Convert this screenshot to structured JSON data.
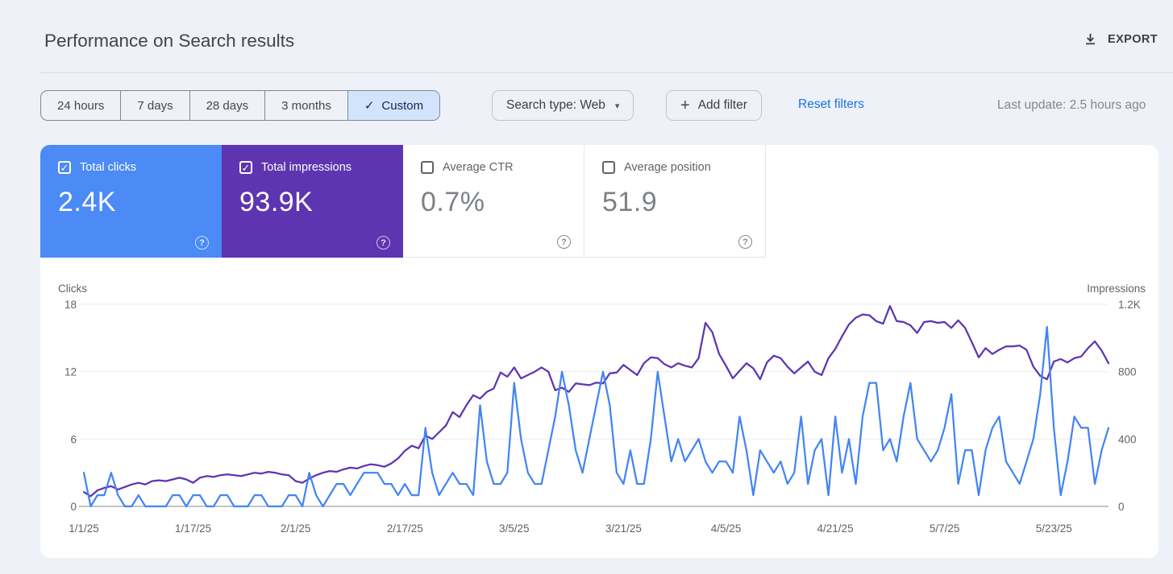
{
  "header": {
    "title": "Performance on Search results",
    "export_label": "EXPORT"
  },
  "icons": {
    "check": "✓",
    "caret_down": "▾",
    "plus": "+",
    "help": "?"
  },
  "filters": {
    "date_tabs": [
      {
        "label": "24 hours",
        "selected": false
      },
      {
        "label": "7 days",
        "selected": false
      },
      {
        "label": "28 days",
        "selected": false
      },
      {
        "label": "3 months",
        "selected": false
      },
      {
        "label": "Custom",
        "selected": true
      }
    ],
    "search_type_label": "Search type: Web",
    "add_filter_label": "Add filter",
    "reset_label": "Reset filters",
    "last_update": "Last update: 2.5 hours ago"
  },
  "metrics": [
    {
      "label": "Total clicks",
      "value": "2.4K",
      "checked": true,
      "color": "#4c8af5"
    },
    {
      "label": "Total impressions",
      "value": "93.9K",
      "checked": true,
      "color": "#5e35b1"
    },
    {
      "label": "Average CTR",
      "value": "0.7%",
      "checked": false,
      "color": "#ffffff"
    },
    {
      "label": "Average position",
      "value": "51.9",
      "checked": false,
      "color": "#ffffff"
    }
  ],
  "chart_data": {
    "type": "line",
    "grid": true,
    "x_axis": {
      "unit": "day",
      "start": "1/1/25",
      "end": "5/31/25",
      "tick_labels": [
        "1/1/25",
        "1/17/25",
        "2/1/25",
        "2/17/25",
        "3/5/25",
        "3/21/25",
        "4/5/25",
        "4/21/25",
        "5/7/25",
        "5/23/25"
      ],
      "tick_day_indices": [
        0,
        16,
        31,
        47,
        63,
        79,
        94,
        110,
        126,
        142
      ]
    },
    "y_left": {
      "label": "Clicks",
      "max": 18,
      "tick_values": [
        18,
        12,
        6,
        0
      ],
      "tick_labels": [
        "18",
        "12",
        "6",
        "0"
      ]
    },
    "y_right": {
      "label": "Impressions",
      "max": 1200,
      "tick_labels": [
        "1.2K",
        "800",
        "400",
        "0"
      ]
    },
    "series": [
      {
        "name": "Clicks",
        "axis": "left",
        "color": "#4285f4",
        "values": [
          3,
          0,
          1,
          1,
          3,
          1,
          0,
          0,
          1,
          0,
          0,
          0,
          0,
          1,
          1,
          0,
          1,
          1,
          0,
          0,
          1,
          1,
          0,
          0,
          0,
          1,
          1,
          0,
          0,
          0,
          1,
          1,
          0,
          3,
          1,
          0,
          1,
          2,
          2,
          1,
          2,
          3,
          3,
          3,
          2,
          2,
          1,
          2,
          1,
          1,
          7,
          3,
          1,
          2,
          3,
          2,
          2,
          1,
          9,
          4,
          2,
          2,
          3,
          11,
          6,
          3,
          2,
          2,
          5,
          8,
          12,
          9,
          5,
          3,
          6,
          9,
          12,
          9,
          3,
          2,
          5,
          2,
          2,
          6,
          12,
          8,
          4,
          6,
          4,
          5,
          6,
          4,
          3,
          4,
          4,
          3,
          8,
          5,
          1,
          5,
          4,
          3,
          4,
          2,
          3,
          8,
          2,
          5,
          6,
          1,
          8,
          3,
          6,
          2,
          8,
          11,
          11,
          5,
          6,
          4,
          8,
          11,
          6,
          5,
          4,
          5,
          7,
          10,
          2,
          5,
          5,
          1,
          5,
          7,
          8,
          4,
          3,
          2,
          4,
          6,
          10,
          16,
          7,
          1,
          4,
          8,
          7,
          7,
          2,
          5,
          7
        ]
      },
      {
        "name": "Impressions",
        "axis": "right",
        "color": "#5e35b1",
        "values": [
          85,
          60,
          95,
          110,
          120,
          100,
          115,
          130,
          140,
          130,
          150,
          155,
          150,
          160,
          170,
          160,
          140,
          170,
          180,
          175,
          185,
          190,
          185,
          180,
          190,
          200,
          195,
          205,
          200,
          190,
          185,
          150,
          140,
          165,
          185,
          200,
          210,
          205,
          220,
          230,
          225,
          240,
          250,
          245,
          235,
          255,
          285,
          330,
          360,
          345,
          420,
          400,
          440,
          480,
          560,
          530,
          600,
          660,
          640,
          680,
          700,
          795,
          770,
          825,
          760,
          780,
          800,
          825,
          800,
          690,
          705,
          680,
          730,
          725,
          720,
          735,
          730,
          790,
          795,
          840,
          810,
          780,
          850,
          885,
          880,
          845,
          825,
          850,
          835,
          825,
          880,
          1090,
          1035,
          905,
          835,
          760,
          805,
          850,
          820,
          755,
          855,
          895,
          880,
          830,
          790,
          825,
          860,
          800,
          780,
          880,
          935,
          1010,
          1080,
          1120,
          1140,
          1135,
          1100,
          1085,
          1190,
          1100,
          1095,
          1075,
          1030,
          1095,
          1100,
          1090,
          1095,
          1060,
          1105,
          1060,
          975,
          885,
          940,
          905,
          930,
          950,
          950,
          955,
          930,
          830,
          775,
          755,
          860,
          875,
          855,
          880,
          890,
          940,
          980,
          925,
          850
        ]
      }
    ]
  }
}
